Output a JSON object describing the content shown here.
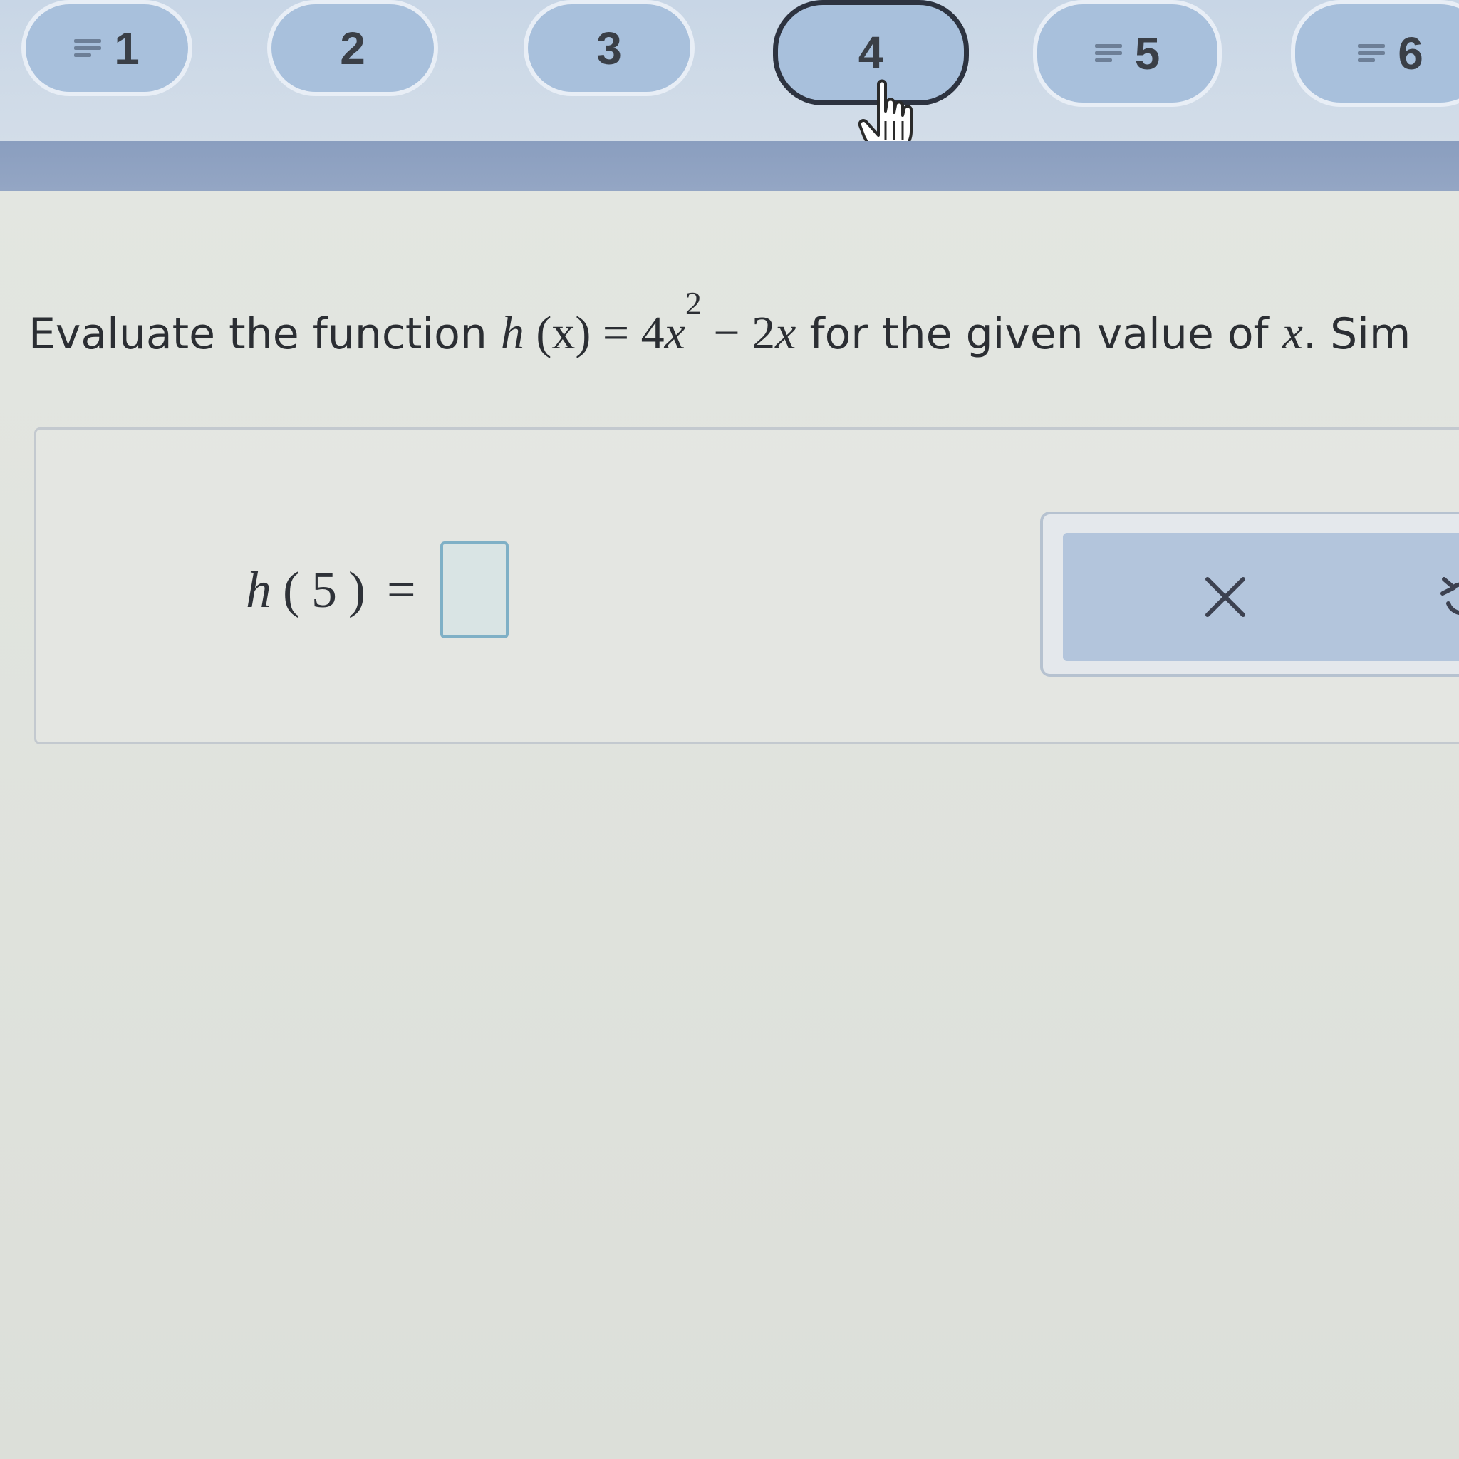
{
  "question_nav": {
    "items": [
      {
        "label": "1",
        "has_list_marker": true,
        "active": false
      },
      {
        "label": "2",
        "has_list_marker": false,
        "active": false
      },
      {
        "label": "3",
        "has_list_marker": false,
        "active": false
      },
      {
        "label": "4",
        "has_list_marker": false,
        "active": true
      },
      {
        "label": "5",
        "has_list_marker": true,
        "active": false
      },
      {
        "label": "6",
        "has_list_marker": true,
        "active": false
      }
    ]
  },
  "question": {
    "lead": "Evaluate the function ",
    "func_name": "h",
    "func_arg": "(x)",
    "equals": " = ",
    "coef": "4",
    "var": "x",
    "exponent": "2",
    "rest": " − 2",
    "var2": "x",
    "tail": " for the given value of ",
    "var3": "x",
    "tail2": ". Sim"
  },
  "answer": {
    "func_name": "h",
    "open_paren": "(",
    "arg": "5",
    "close_paren": ")",
    "equals": "=",
    "input_value": ""
  },
  "tools": {
    "clear_icon": "x-icon",
    "undo_icon": "undo-icon"
  },
  "colors": {
    "nav_button": "#a8c0dc",
    "nav_active_border": "#2d3340",
    "divider": "#8a9ebf",
    "answer_box_border": "#7fb0c6"
  }
}
